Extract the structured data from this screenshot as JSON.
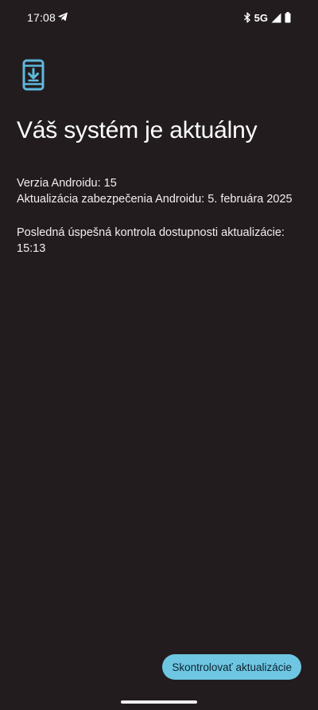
{
  "status_bar": {
    "time": "17:08",
    "network": "5G",
    "icons": [
      "telegram-icon",
      "bluetooth-icon",
      "signal-icon",
      "battery-icon"
    ]
  },
  "page": {
    "icon": "system-update-icon",
    "title": "Váš systém je aktuálny",
    "android_version": "Verzia Androidu: 15",
    "security_update": "Aktualizácia zabezpečenia Androidu: 5. februára 2025",
    "last_check_label": "Posledná úspešná kontrola dostupnosti aktualizácie:",
    "last_check_time": "15:13"
  },
  "actions": {
    "check_updates": "Skontrolovať aktualizácie"
  },
  "colors": {
    "background": "#221c1f",
    "accent": "#6ec6e2",
    "icon": "#5fb8dc"
  }
}
